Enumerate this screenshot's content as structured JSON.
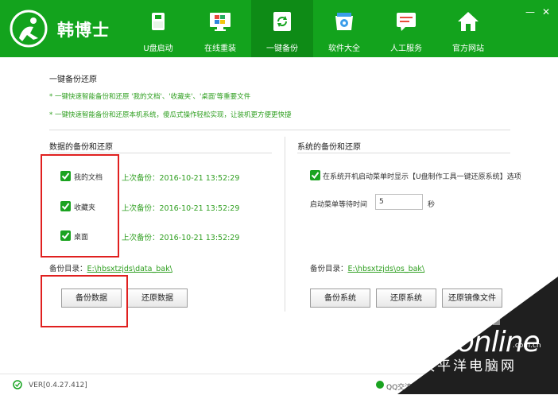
{
  "header": {
    "brand": "韩博士",
    "nav": [
      {
        "label": "U盘启动",
        "icon": "usb-drive-icon"
      },
      {
        "label": "在线重装",
        "icon": "windows-monitor-icon"
      },
      {
        "label": "一键备份",
        "icon": "refresh-backup-icon",
        "active": true
      },
      {
        "label": "软件大全",
        "icon": "software-store-icon"
      },
      {
        "label": "人工服务",
        "icon": "chat-service-icon"
      },
      {
        "label": "官方网站",
        "icon": "home-icon"
      }
    ],
    "minimize": "—",
    "close": "✕"
  },
  "main": {
    "title": "一键备份还原",
    "notes": [
      "* 一键快速智能备份和还原 '我的文档'、'收藏夹'、'桌面'等重要文件",
      "* 一键快速智能备份和还原本机系统，傻瓜式操作轻松实现，让装机更方便更快捷"
    ]
  },
  "data_section": {
    "title": "数据的备份和还原",
    "items": [
      {
        "label": "我的文档",
        "last_backup": "上次备份：2016-10-21 13:52:29",
        "checked": true
      },
      {
        "label": "收藏夹",
        "last_backup": "上次备份：2016-10-21 13:52:29",
        "checked": true
      },
      {
        "label": "桌面",
        "last_backup": "上次备份：2016-10-21 13:52:29",
        "checked": true
      }
    ],
    "dir_label": "备份目录：",
    "dir_path": "E:\\hbsxtzjds\\data_bak\\",
    "backup_button": "备份数据",
    "restore_button": "还原数据"
  },
  "system_section": {
    "title": "系统的备份和还原",
    "option_label": "在系统开机启动菜单时显示【U盘制作工具一键还原系统】选项",
    "option_checked": true,
    "wait_label": "启动菜单等待时间",
    "wait_value": "5",
    "wait_unit": "秒",
    "dir_label": "备份目录：",
    "dir_path": "E:\\hbsxtzjds\\os_bak\\",
    "backup_button": "备份系统",
    "restore_button": "还原系统",
    "restore_image_button": "还原镜像文件"
  },
  "footer": {
    "version": "VER[0.4.27.412]",
    "qq": "QQ交流"
  },
  "watermark": {
    "brand": "PConline",
    "domain": ".com.cn",
    "subtitle": "太平洋电脑网"
  },
  "colors": {
    "header_green": "#13a31d",
    "active_tab": "#0e8b16",
    "note_green": "#2f9f20",
    "highlight_red": "#e0201f"
  }
}
